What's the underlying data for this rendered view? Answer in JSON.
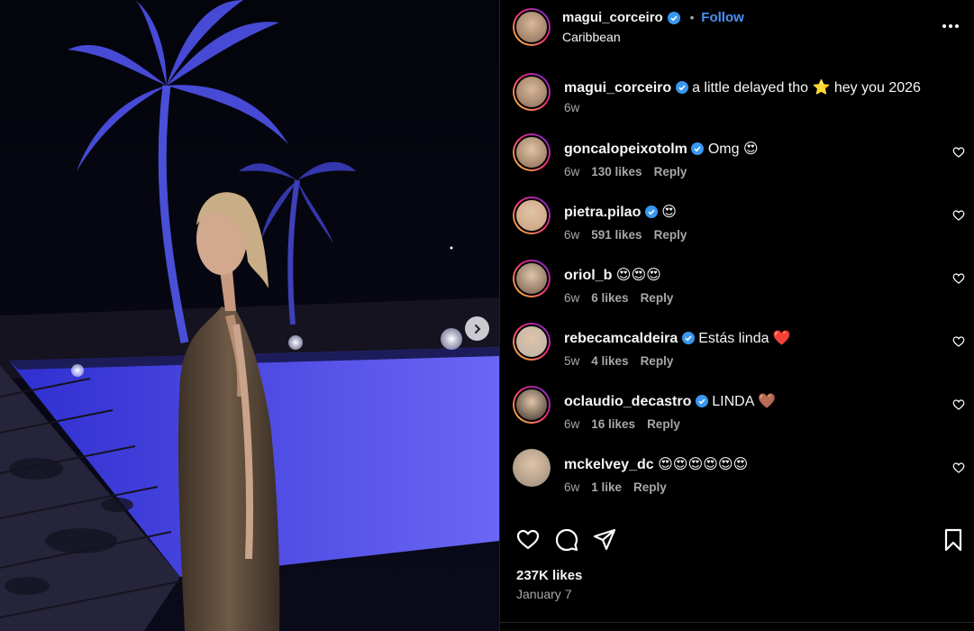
{
  "post": {
    "author": "magui_corceiro",
    "location": "Caribbean",
    "follow_label": "Follow",
    "separator": "•",
    "caption": {
      "username": "magui_corceiro",
      "text": "a little delayed tho ⭐ hey you 2026",
      "age": "6w"
    },
    "likes_total": "237K likes",
    "date": "January 7"
  },
  "comments": [
    {
      "username": "goncalopeixotolm",
      "verified": true,
      "text": "Omg 😍",
      "age": "6w",
      "likes": "130 likes",
      "reply": "Reply",
      "avatar_color": "#8a6a4f"
    },
    {
      "username": "pietra.pilao",
      "verified": true,
      "text": "😍",
      "age": "6w",
      "likes": "591 likes",
      "reply": "Reply",
      "avatar_color": "#c9a07c"
    },
    {
      "username": "oriol_b",
      "verified": false,
      "text": "😍😍😍",
      "age": "6w",
      "likes": "6 likes",
      "reply": "Reply",
      "avatar_color": "#6f5a4a"
    },
    {
      "username": "rebecamcaldeira",
      "verified": true,
      "text": "Estás linda ❤️",
      "age": "5w",
      "likes": "4 likes",
      "reply": "Reply",
      "avatar_color": "#b9b1a6"
    },
    {
      "username": "oclaudio_decastro",
      "verified": true,
      "text": "LINDA 🤎",
      "age": "6w",
      "likes": "16 likes",
      "reply": "Reply",
      "avatar_color": "#3a3028"
    },
    {
      "username": "mckelvey_dc",
      "verified": false,
      "text": "😍😍😍😍😍😍",
      "age": "6w",
      "likes": "1 like",
      "reply": "Reply",
      "avatar_color": "#9a8a78"
    }
  ],
  "colors": {
    "accent": "#4793f5",
    "verified": "#3897f0",
    "muted": "#a8a8a8"
  },
  "icons": [
    "next-chevron-icon",
    "more-options-icon",
    "verified-badge-icon",
    "heart-icon",
    "like-icon",
    "comment-icon",
    "share-icon",
    "save-bookmark-icon"
  ]
}
